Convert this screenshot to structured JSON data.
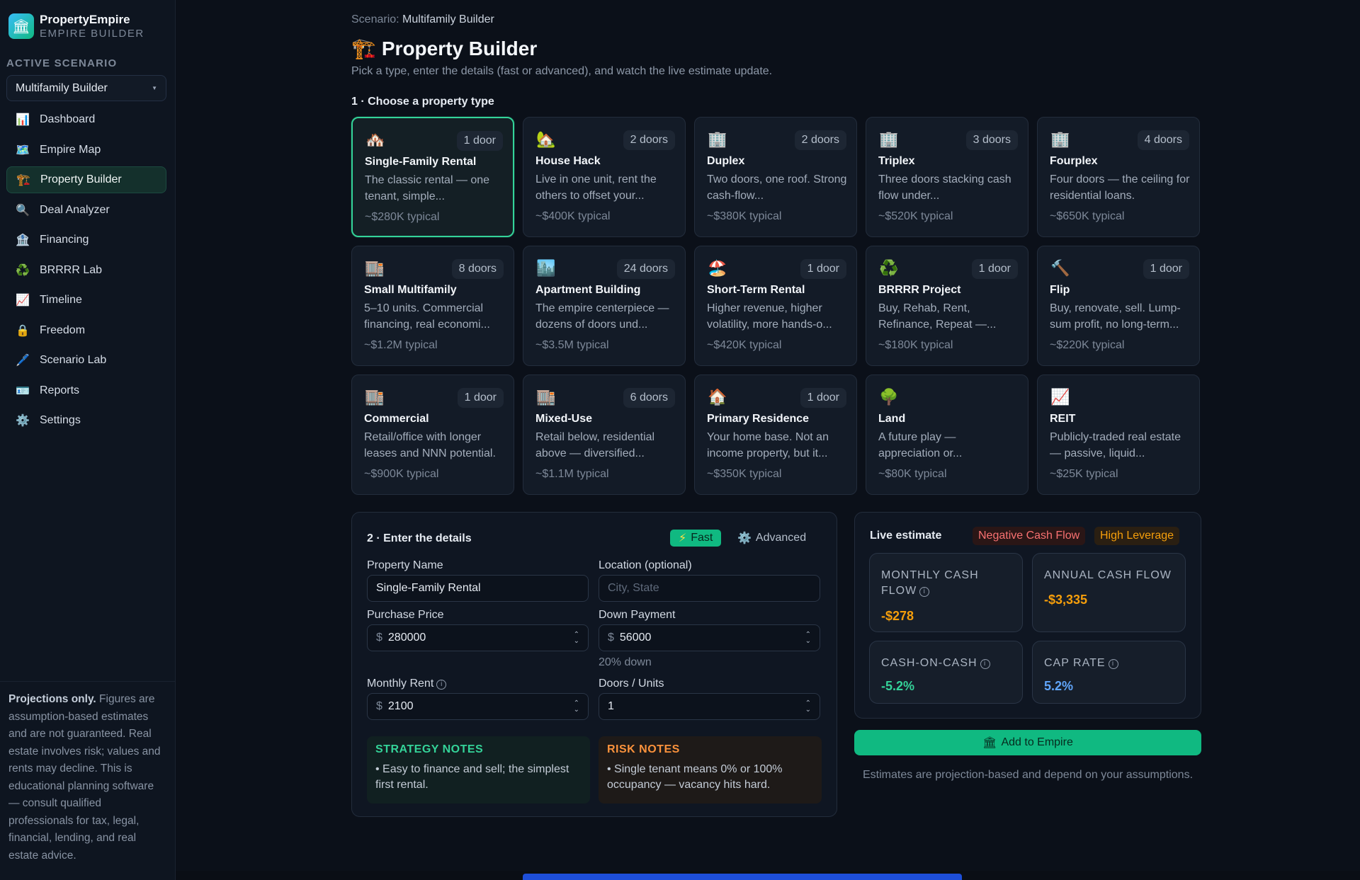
{
  "app": {
    "name": "PropertyEmpire",
    "subtitle": "EMPIRE BUILDER"
  },
  "sidebar": {
    "section_label": "ACTIVE SCENARIO",
    "scenario_value": "Multifamily Builder",
    "items": [
      {
        "label": "Dashboard",
        "icon": "bar-chart-icon",
        "glyph": "📊"
      },
      {
        "label": "Empire Map",
        "icon": "map-icon",
        "glyph": "🗺️"
      },
      {
        "label": "Property Builder",
        "icon": "crane-icon",
        "glyph": "🏗️",
        "active": true
      },
      {
        "label": "Deal Analyzer",
        "icon": "magnifier-icon",
        "glyph": "🔍"
      },
      {
        "label": "Financing",
        "icon": "bank-icon",
        "glyph": "🏦"
      },
      {
        "label": "BRRRR Lab",
        "icon": "recycle-icon",
        "glyph": "♻️"
      },
      {
        "label": "Timeline",
        "icon": "trend-chart-icon",
        "glyph": "📈"
      },
      {
        "label": "Freedom",
        "icon": "lock-icon",
        "glyph": "🔒"
      },
      {
        "label": "Scenario Lab",
        "icon": "pencil-icon",
        "glyph": "🖊️"
      },
      {
        "label": "Reports",
        "icon": "card-icon",
        "glyph": "🪪"
      },
      {
        "label": "Settings",
        "icon": "gear-icon",
        "glyph": "⚙️"
      }
    ],
    "disclaimer_bold": "Projections only.",
    "disclaimer_text": " Figures are assumption-based estimates and are not guaranteed. Real estate involves risk; values and rents may decline. This is educational planning software — consult qualified professionals for tax, legal, financial, lending, and real estate advice."
  },
  "header": {
    "crumb_label": "Scenario:",
    "crumb_value": "Multifamily Builder",
    "title_glyph": "🏗️",
    "title": "Property Builder",
    "subtitle": "Pick a type, enter the details (fast or advanced), and watch the live estimate update."
  },
  "step1_label": "1 · Choose a property type",
  "property_types": [
    {
      "glyph": "🏘️",
      "icon": "houses-icon",
      "badge": "1 door",
      "title": "Single-Family Rental",
      "desc": "The classic rental — one tenant, simple...",
      "price": "~$280K typical",
      "selected": true
    },
    {
      "glyph": "🏡",
      "icon": "house-garden-icon",
      "badge": "2 doors",
      "title": "House Hack",
      "desc": "Live in one unit, rent the others to offset your...",
      "price": "~$400K typical"
    },
    {
      "glyph": "🏢",
      "icon": "building-icon",
      "badge": "2 doors",
      "title": "Duplex",
      "desc": "Two doors, one roof. Strong cash-flow...",
      "price": "~$380K typical"
    },
    {
      "glyph": "🏢",
      "icon": "building-icon",
      "badge": "3 doors",
      "title": "Triplex",
      "desc": "Three doors stacking cash flow under...",
      "price": "~$520K typical"
    },
    {
      "glyph": "🏢",
      "icon": "building-icon",
      "badge": "4 doors",
      "title": "Fourplex",
      "desc": "Four doors — the ceiling for residential loans.",
      "price": "~$650K typical"
    },
    {
      "glyph": "🏬",
      "icon": "office-icon",
      "badge": "8 doors",
      "title": "Small Multifamily",
      "desc": "5–10 units. Commercial financing, real economi...",
      "price": "~$1.2M typical"
    },
    {
      "glyph": "🏙️",
      "icon": "cityscape-icon",
      "badge": "24 doors",
      "title": "Apartment Building",
      "desc": "The empire centerpiece — dozens of doors und...",
      "price": "~$3.5M typical"
    },
    {
      "glyph": "🏖️",
      "icon": "beach-icon",
      "badge": "1 door",
      "title": "Short-Term Rental",
      "desc": "Higher revenue, higher volatility, more hands-o...",
      "price": "~$420K typical"
    },
    {
      "glyph": "♻️",
      "icon": "recycle-icon",
      "badge": "1 door",
      "title": "BRRRR Project",
      "desc": "Buy, Rehab, Rent, Refinance, Repeat —...",
      "price": "~$180K typical"
    },
    {
      "glyph": "🔨",
      "icon": "hammer-icon",
      "badge": "1 door",
      "title": "Flip",
      "desc": "Buy, renovate, sell. Lump-sum profit, no long-term...",
      "price": "~$220K typical"
    },
    {
      "glyph": "🏬",
      "icon": "office-icon",
      "badge": "1 door",
      "title": "Commercial",
      "desc": "Retail/office with longer leases and NNN potential.",
      "price": "~$900K typical"
    },
    {
      "glyph": "🏬",
      "icon": "office-icon",
      "badge": "6 doors",
      "title": "Mixed-Use",
      "desc": "Retail below, residential above — diversified...",
      "price": "~$1.1M typical"
    },
    {
      "glyph": "🏠",
      "icon": "house-icon",
      "badge": "1 door",
      "title": "Primary Residence",
      "desc": "Your home base. Not an income property, but it...",
      "price": "~$350K typical"
    },
    {
      "glyph": "🌳",
      "icon": "tree-icon",
      "badge": "",
      "title": "Land",
      "desc": "A future play — appreciation or...",
      "price": "~$80K typical"
    },
    {
      "glyph": "📈",
      "icon": "trend-chart-icon",
      "badge": "",
      "title": "REIT",
      "desc": "Publicly-traded real estate — passive, liquid...",
      "price": "~$25K typical"
    }
  ],
  "details": {
    "heading": "2 · Enter the details",
    "mode_fast": "Fast",
    "mode_advanced": "Advanced",
    "property_name_label": "Property Name",
    "property_name_value": "Single-Family Rental",
    "location_label": "Location (optional)",
    "location_placeholder": "City, State",
    "purchase_price_label": "Purchase Price",
    "purchase_price_value": "280000",
    "down_payment_label": "Down Payment",
    "down_payment_value": "56000",
    "down_payment_hint": "20% down",
    "monthly_rent_label": "Monthly Rent",
    "monthly_rent_value": "2100",
    "doors_label": "Doors / Units",
    "doors_value": "1",
    "currency": "$",
    "strategy_title": "STRATEGY NOTES",
    "strategy_body": "• Easy to finance and sell; the simplest first rental.",
    "risk_title": "RISK NOTES",
    "risk_body": "• Single tenant means 0% or 100% occupancy — vacancy hits hard."
  },
  "estimate": {
    "heading": "Live estimate",
    "tag_negative": "Negative Cash Flow",
    "tag_leverage": "High Leverage",
    "monthly_cash_flow_label": "MONTHLY CASH FLOW",
    "monthly_cash_flow_value": "-$278",
    "annual_cash_flow_label": "ANNUAL CASH FLOW",
    "annual_cash_flow_value": "-$3,335",
    "cash_on_cash_label": "CASH-ON-CASH",
    "cash_on_cash_value": "-5.2%",
    "cap_rate_label": "CAP RATE",
    "cap_rate_value": "5.2%",
    "add_button": "Add to Empire",
    "note": "Estimates are projection-based and depend on your assumptions."
  },
  "colors": {
    "accent": "#10b981",
    "negative": "#f87171",
    "warning": "#f59e0b",
    "info": "#60a5fa"
  }
}
